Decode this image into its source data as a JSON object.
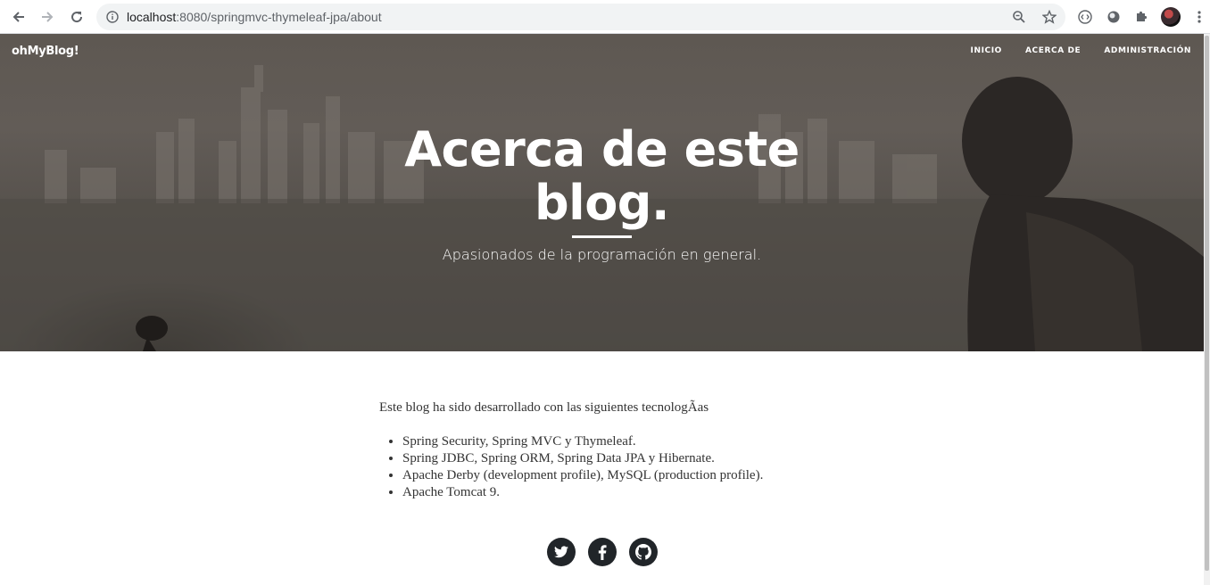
{
  "browser": {
    "url_host": "localhost",
    "url_rest": ":8080/springmvc-thymeleaf-jpa/about"
  },
  "site": {
    "brand": "ohMyBlog!",
    "menu": [
      {
        "label": "INICIO"
      },
      {
        "label": "ACERCA DE"
      },
      {
        "label": "ADMINISTRACIÓN"
      }
    ]
  },
  "hero": {
    "title_line1": "Acerca de este",
    "title_line2": "blog.",
    "subtitle": "Apasionados de la programación en general."
  },
  "content": {
    "intro": "Este blog ha sido desarrollado con las siguientes tecnologÃas",
    "items": [
      "Spring Security, Spring MVC y Thymeleaf.",
      "Spring JDBC, Spring ORM, Spring Data JPA y Hibernate.",
      "Apache Derby (development profile), MySQL (production profile).",
      "Apache Tomcat 9."
    ]
  },
  "social": [
    {
      "icon": "twitter-icon"
    },
    {
      "icon": "facebook-icon"
    },
    {
      "icon": "github-icon"
    }
  ],
  "colors": {
    "hero_overlay": "#5e5852",
    "social_circle": "#212529",
    "body_text": "#333333"
  }
}
